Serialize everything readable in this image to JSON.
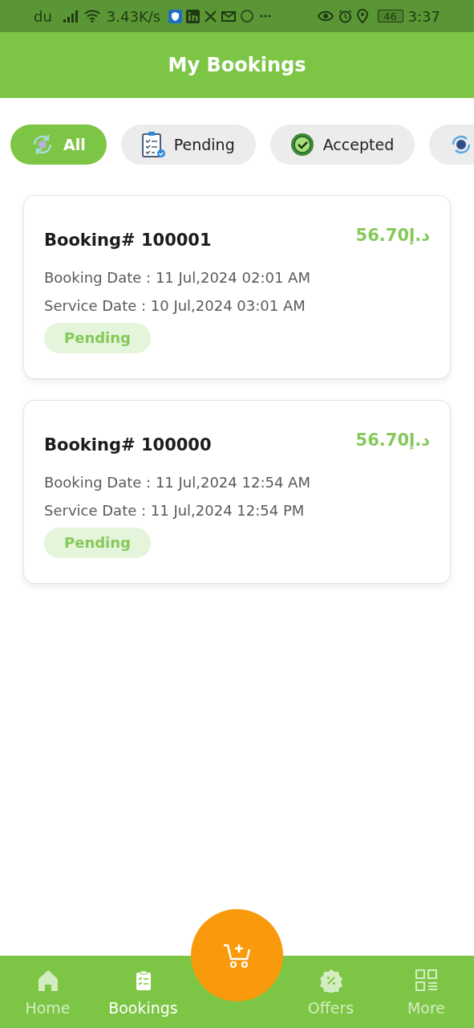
{
  "status_bar": {
    "carrier": "du",
    "speed": "3.43K/s",
    "battery": "46",
    "time": "3:37"
  },
  "header": {
    "title": "My Bookings"
  },
  "tabs": [
    {
      "label": "All",
      "selected": true
    },
    {
      "label": "Pending",
      "selected": false
    },
    {
      "label": "Accepted",
      "selected": false
    },
    {
      "selected": false
    }
  ],
  "bookings": [
    {
      "title": "Booking# 100001",
      "price": "56.70د.إ",
      "booking_date": "Booking Date : 11 Jul,2024 02:01 AM",
      "service_date": "Service Date : 10 Jul,2024 03:01 AM",
      "status": "Pending"
    },
    {
      "title": "Booking# 100000",
      "price": "56.70د.إ",
      "booking_date": "Booking Date : 11 Jul,2024 12:54 AM",
      "service_date": "Service Date : 11 Jul,2024 12:54 PM",
      "status": "Pending"
    }
  ],
  "bottom_nav": [
    {
      "label": "Home",
      "selected": false
    },
    {
      "label": "Bookings",
      "selected": true
    },
    {
      "label": "Offers",
      "selected": false
    },
    {
      "label": "More",
      "selected": false
    }
  ]
}
